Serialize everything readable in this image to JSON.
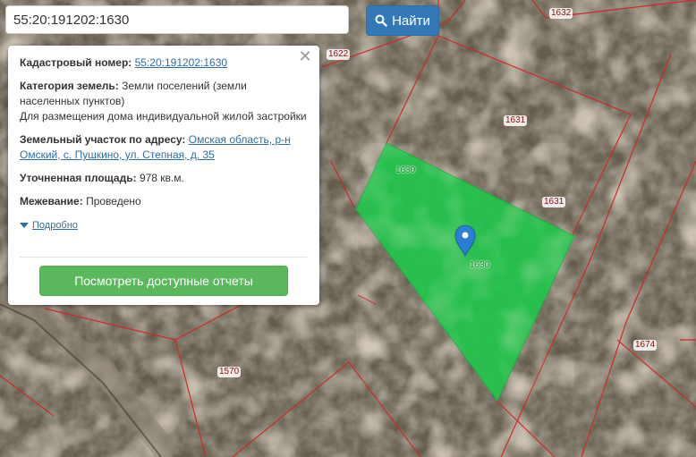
{
  "search": {
    "value": "55:20:191202:1630",
    "button_label": "Найти",
    "button_icon": "search-icon"
  },
  "info": {
    "cadastral_label": "Кадастровый номер:",
    "cadastral_value": "55:20:191202:1630",
    "category_label": "Категория земель:",
    "category_value": "Земли поселений (земли населенных пунктов)",
    "category_purpose": "Для размещения дома индивидуальной жилой застройки",
    "address_label": "Земельный участок по адресу:",
    "address_value": "Омская область, р-н Омский, с. Пушкино, ул. Степная, д. 35",
    "area_label": "Уточненная площадь:",
    "area_value": "978 кв.м.",
    "survey_label": "Межевание:",
    "survey_value": "Проведено",
    "more_link": "Подробно",
    "reports_button": "Посмотреть доступные отчеты",
    "close_icon": "close-icon"
  },
  "map": {
    "parcel_labels": [
      {
        "id": "1632",
        "text": "1632"
      },
      {
        "id": "1622",
        "text": "1622"
      },
      {
        "id": "1631a",
        "text": "1631"
      },
      {
        "id": "1631b",
        "text": "1631"
      },
      {
        "id": "1630a",
        "text": "1630"
      },
      {
        "id": "1630b",
        "text": "1630"
      },
      {
        "id": "1674",
        "text": "1674"
      },
      {
        "id": "1570",
        "text": "1570"
      }
    ],
    "selected_parcel_color": "#22c64c",
    "boundary_color": "#d02828",
    "marker_color": "#2b7ed1",
    "marker_icon": "map-pin-icon"
  }
}
